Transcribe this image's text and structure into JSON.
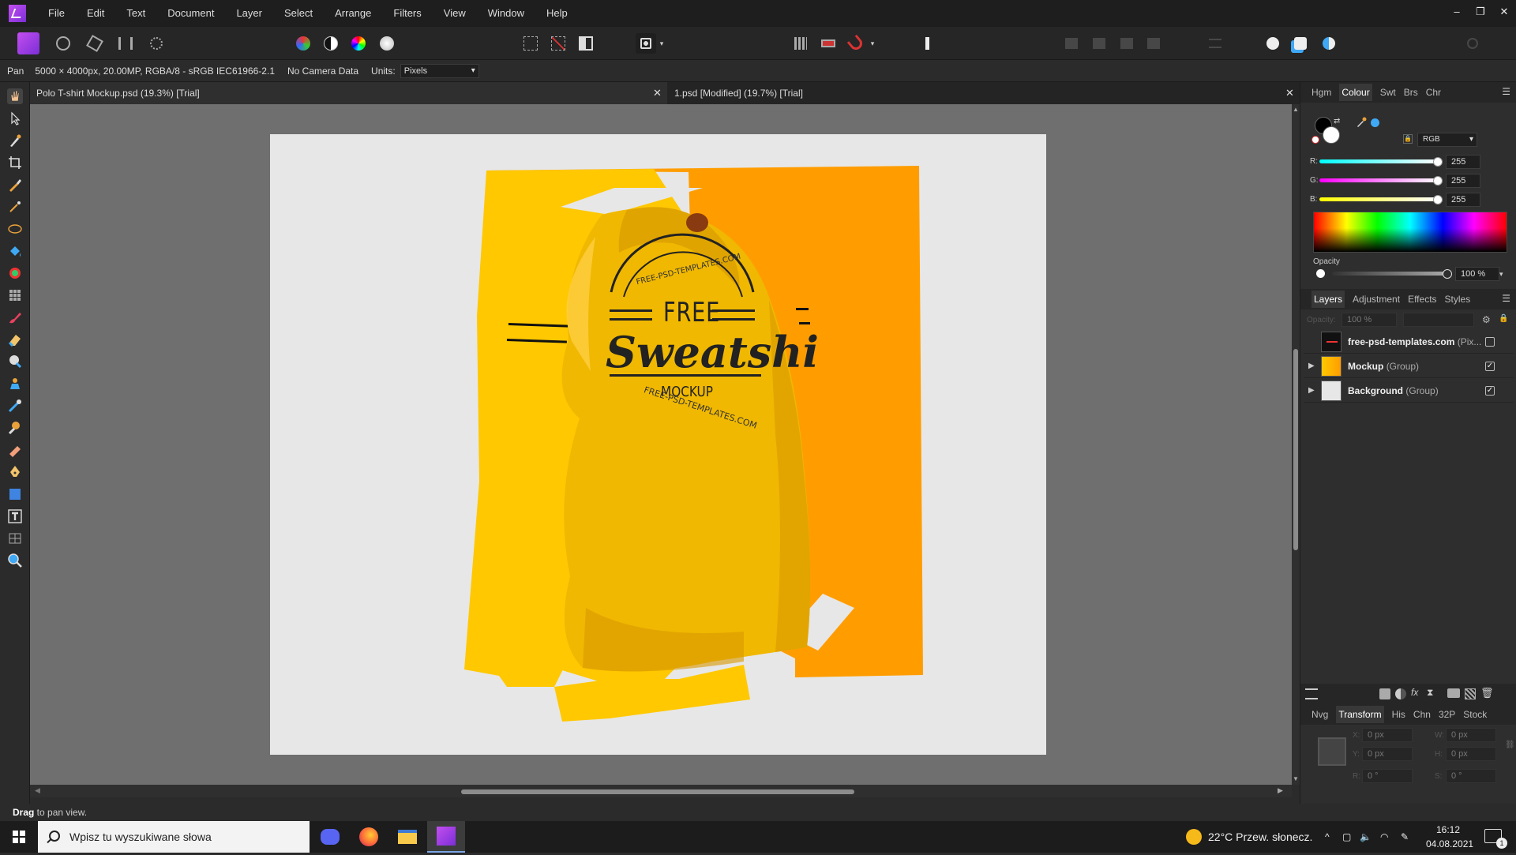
{
  "menubar": {
    "items": [
      "File",
      "Edit",
      "Text",
      "Document",
      "Layer",
      "Select",
      "Arrange",
      "Filters",
      "View",
      "Window",
      "Help"
    ],
    "window_controls": [
      "–",
      "❐",
      "✕"
    ]
  },
  "context": {
    "tool_name": "Pan",
    "doc_info": "5000 × 4000px, 20.00MP, RGBA/8 - sRGB IEC61966-2.1",
    "camera": "No Camera Data",
    "units_label": "Units:",
    "units_value": "Pixels"
  },
  "tabs": [
    {
      "label": "Polo T-shirt Mockup.psd (19.3%) [Trial]"
    },
    {
      "label": "1.psd [Modified] (19.7%) [Trial]"
    }
  ],
  "tab_close": "✕",
  "artwork": {
    "line1": "FREE",
    "line2": "Sweatshi",
    "line3": "MOCKUP",
    "arc_top": "FREE-PSD-TEMPLATES.COM",
    "arc_bottom": "FREE-PSD-TEMPLATES.COM"
  },
  "colours": {
    "orange": "#ff9d00",
    "yellow": "#ffc800",
    "shirt": "#f0b800",
    "accent": "#3fa9f5"
  },
  "colour_panel": {
    "tabs": [
      "Hgm",
      "Colour",
      "Swt",
      "Brs",
      "Chr"
    ],
    "active_tab": "Colour",
    "model": "RGB",
    "channels": [
      {
        "label": "R:",
        "value": "255"
      },
      {
        "label": "G:",
        "value": "255"
      },
      {
        "label": "B:",
        "value": "255"
      }
    ],
    "opacity_label": "Opacity",
    "opacity_value": "100 %"
  },
  "layers_panel": {
    "tabs": [
      "Layers",
      "Adjustment",
      "Effects",
      "Styles"
    ],
    "active_tab": "Layers",
    "opacity_label": "Opacity:",
    "opacity_value": "100 %",
    "layers": [
      {
        "name": "free-psd-templates.com",
        "type": "(Pix...",
        "visible": false
      },
      {
        "name": "Mockup",
        "type": "(Group)",
        "visible": true
      },
      {
        "name": "Background",
        "type": "(Group)",
        "visible": true
      }
    ]
  },
  "transform_panel": {
    "tabs": [
      "Nvg",
      "Transform",
      "His",
      "Chn",
      "32P",
      "Stock"
    ],
    "active_tab": "Transform",
    "x_label": "X:",
    "x": "0 px",
    "y_label": "Y:",
    "y": "0 px",
    "w_label": "W:",
    "w": "0 px",
    "h_label": "H:",
    "h": "0 px",
    "r_label": "R:",
    "r": "0 °",
    "s_label": "S:",
    "s": "0 °"
  },
  "status": {
    "bold": "Drag",
    "text": " to pan view."
  },
  "taskbar": {
    "search_placeholder": "Wpisz tu wyszukiwane słowa",
    "weather": "22°C  Przew. słonecz.",
    "time": "16:12",
    "date": "04.08.2021",
    "notifications": "1"
  }
}
